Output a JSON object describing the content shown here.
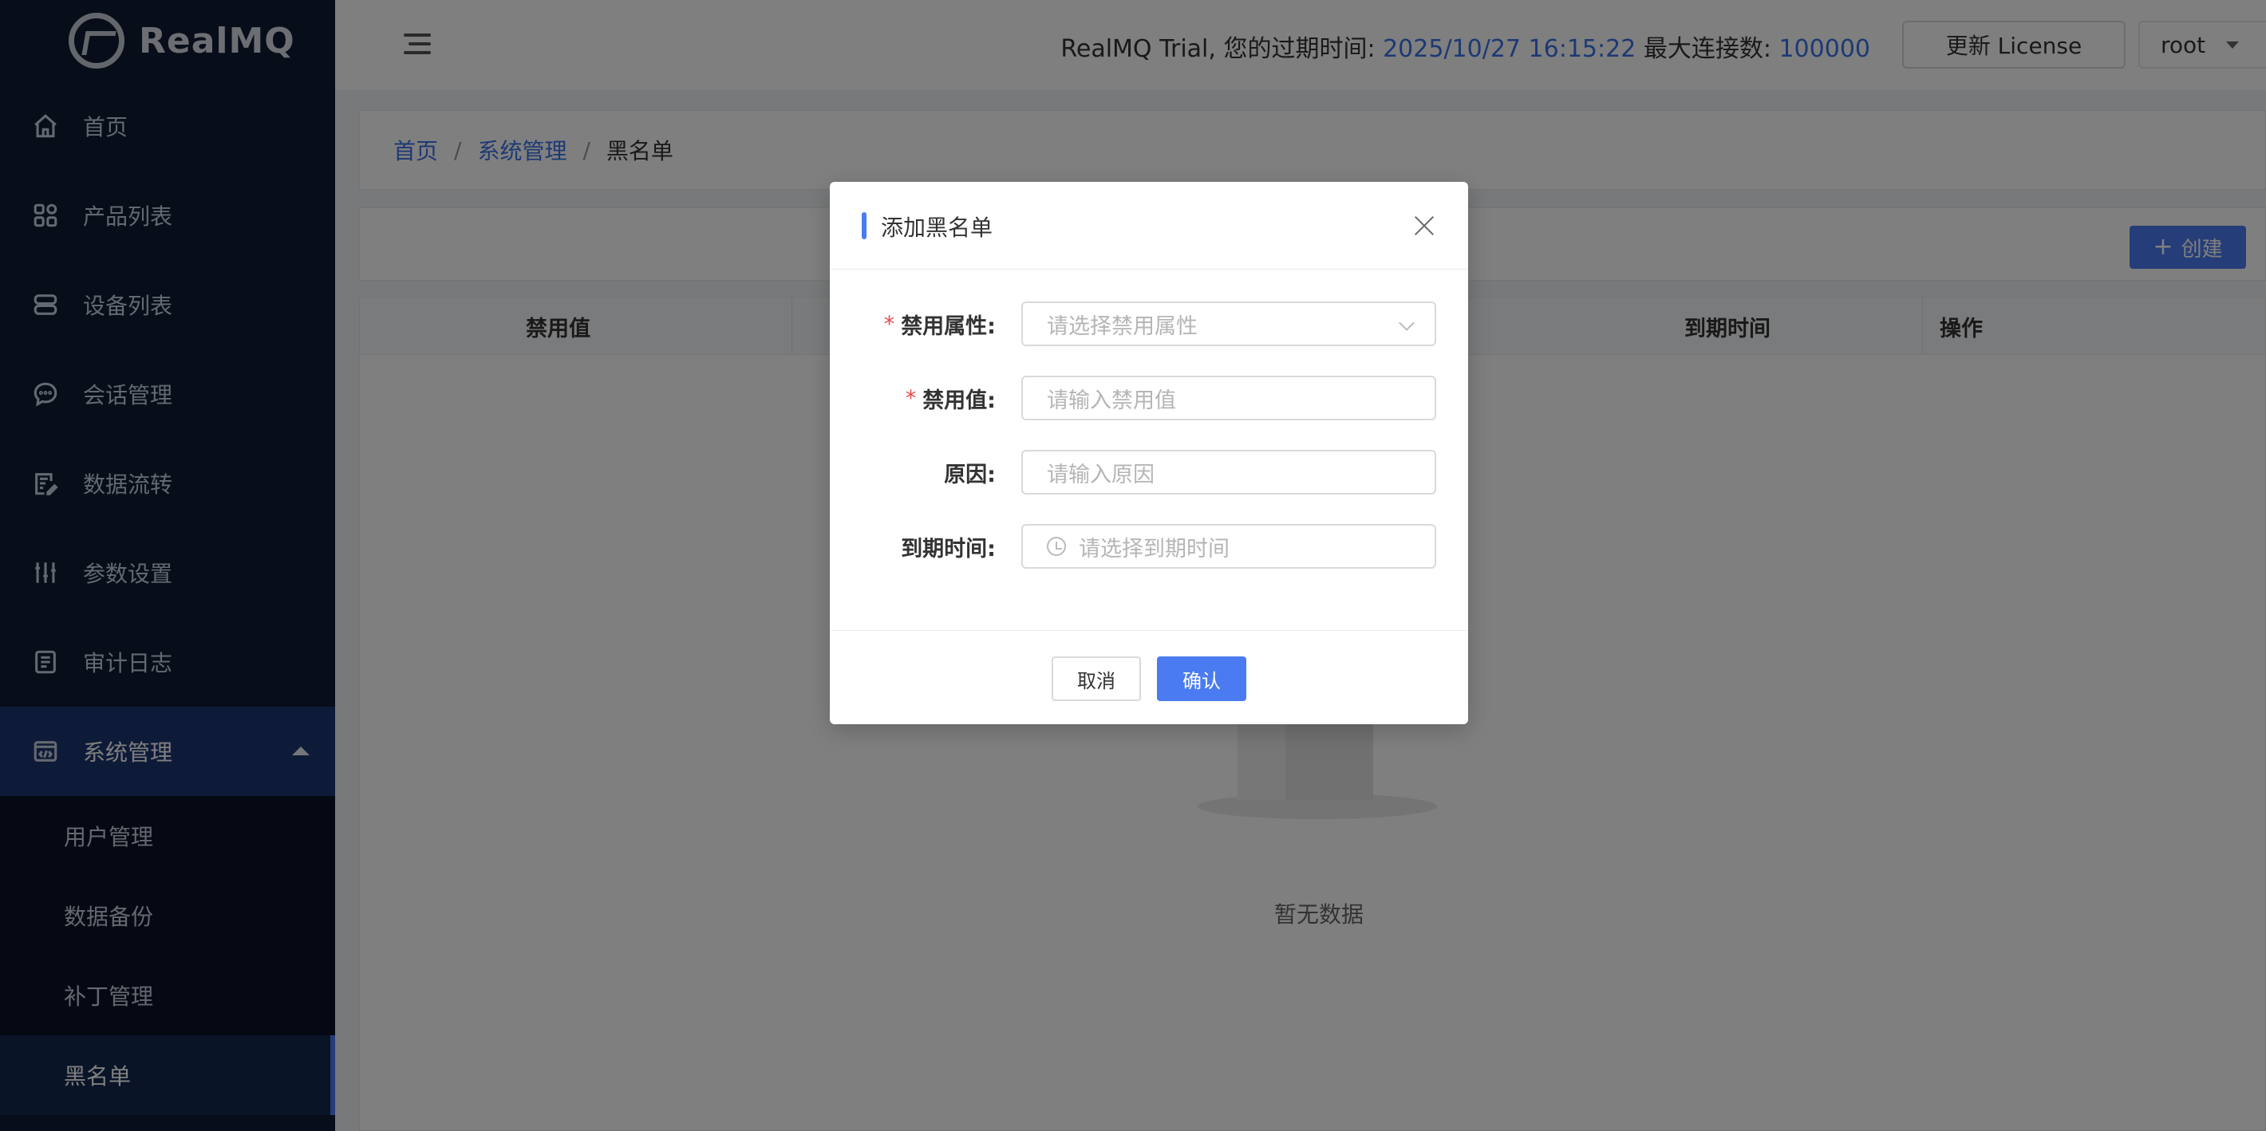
{
  "app": {
    "logo_text": "RealMQ"
  },
  "sidebar": {
    "items": [
      {
        "label": "首页",
        "icon": "home-icon"
      },
      {
        "label": "产品列表",
        "icon": "grid-icon"
      },
      {
        "label": "设备列表",
        "icon": "server-icon"
      },
      {
        "label": "会话管理",
        "icon": "chat-icon"
      },
      {
        "label": "数据流转",
        "icon": "document-edit-icon"
      },
      {
        "label": "参数设置",
        "icon": "sliders-icon"
      },
      {
        "label": "审计日志",
        "icon": "log-icon"
      },
      {
        "label": "系统管理",
        "icon": "code-window-icon"
      }
    ],
    "sub_items": [
      {
        "label": "用户管理"
      },
      {
        "label": "数据备份"
      },
      {
        "label": "补丁管理"
      },
      {
        "label": "黑名单"
      }
    ]
  },
  "header": {
    "trial_prefix": "RealMQ Trial, 您的过期时间: ",
    "expire_time": "2025/10/27 16:15:22",
    "max_conn_label": " 最大连接数: ",
    "max_conn_value": "100000",
    "license_button": "更新 License",
    "user": "root"
  },
  "breadcrumb": {
    "home": "首页",
    "parent": "系统管理",
    "current": "黑名单"
  },
  "toolbar": {
    "create_label": "创建"
  },
  "table": {
    "columns": [
      "禁用值",
      "到期时间",
      "操作"
    ],
    "empty_text": "暂无数据"
  },
  "modal": {
    "title": "添加黑名单",
    "fields": [
      {
        "label": "禁用属性:",
        "required": true,
        "placeholder": "请选择禁用属性",
        "type": "select"
      },
      {
        "label": "禁用值:",
        "required": true,
        "placeholder": "请输入禁用值",
        "type": "text"
      },
      {
        "label": "原因:",
        "required": false,
        "placeholder": "请输入原因",
        "type": "text"
      },
      {
        "label": "到期时间:",
        "required": false,
        "placeholder": "请选择到期时间",
        "type": "datetime"
      }
    ],
    "cancel_label": "取消",
    "confirm_label": "确认"
  },
  "colors": {
    "accent": "#4a7bf0",
    "sidebar_bg": "#0f1a33",
    "required": "#e84a4a"
  }
}
